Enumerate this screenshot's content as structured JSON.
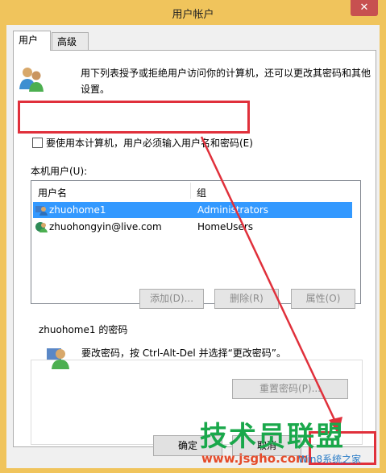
{
  "window": {
    "title": "用户帐户",
    "close_label": "✕"
  },
  "tabs": [
    {
      "label": "用户"
    },
    {
      "label": "高级"
    }
  ],
  "intro_text": "用下列表授予或拒绝用户访问你的计算机，还可以更改其密码和其他设置。",
  "require_login_checkbox": {
    "label": "要使用本计算机，用户必须输入用户名和密码(E)",
    "checked": false
  },
  "local_users": {
    "label": "本机用户(U):",
    "columns": [
      "用户名",
      "组"
    ],
    "rows": [
      {
        "name": "zhuohome1",
        "group": "Administrators",
        "selected": true
      },
      {
        "name": "zhuohongyin@live.com",
        "group": "HomeUsers",
        "selected": false
      }
    ]
  },
  "buttons": {
    "add": "添加(D)...",
    "remove": "删除(R)",
    "properties": "属性(O)"
  },
  "password_group": {
    "title": "zhuohome1 的密码",
    "text": "要改密码，按 Ctrl-Alt-Del 并选择“更改密码”。",
    "reset_button": "重置密码(P)..."
  },
  "footer": {
    "ok": "确定",
    "cancel": "取消"
  },
  "watermark": {
    "main": "技术员联盟",
    "url": "www.jsgho.com",
    "suffix": "Win8系统之家"
  },
  "colors": {
    "accent_red": "#e0303b",
    "selection": "#3399ff",
    "title_bar": "#f0c45c"
  }
}
